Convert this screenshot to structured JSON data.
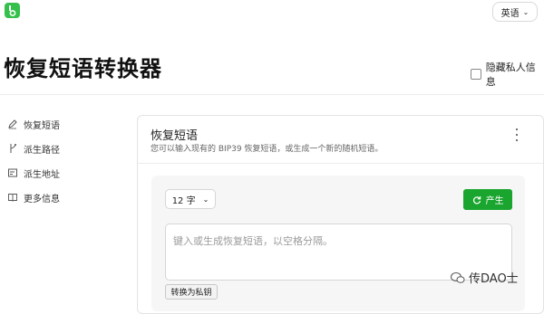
{
  "header": {
    "language_label": "英语",
    "page_title": "恢复短语转换器",
    "hide_private_label": "隐藏私人信息"
  },
  "sidebar": {
    "items": [
      {
        "label": "恢复短语",
        "icon": "pen-icon"
      },
      {
        "label": "派生路径",
        "icon": "branch-icon"
      },
      {
        "label": "派生地址",
        "icon": "address-icon"
      },
      {
        "label": "更多信息",
        "icon": "book-icon"
      }
    ]
  },
  "card": {
    "title": "恢复短语",
    "subtitle": "您可以输入现有的 BIP39 恢复短语，或生成一个新的随机短语。",
    "word_count": "12 字",
    "generate_label": "产生",
    "phrase_placeholder": "键入或生成恢复短语，以空格分隔。",
    "convert_label": "转换为私钥"
  },
  "watermark": {
    "text": "传DAO士"
  },
  "colors": {
    "accent_green": "#1aa52f",
    "logo_green": "#35c04b"
  }
}
